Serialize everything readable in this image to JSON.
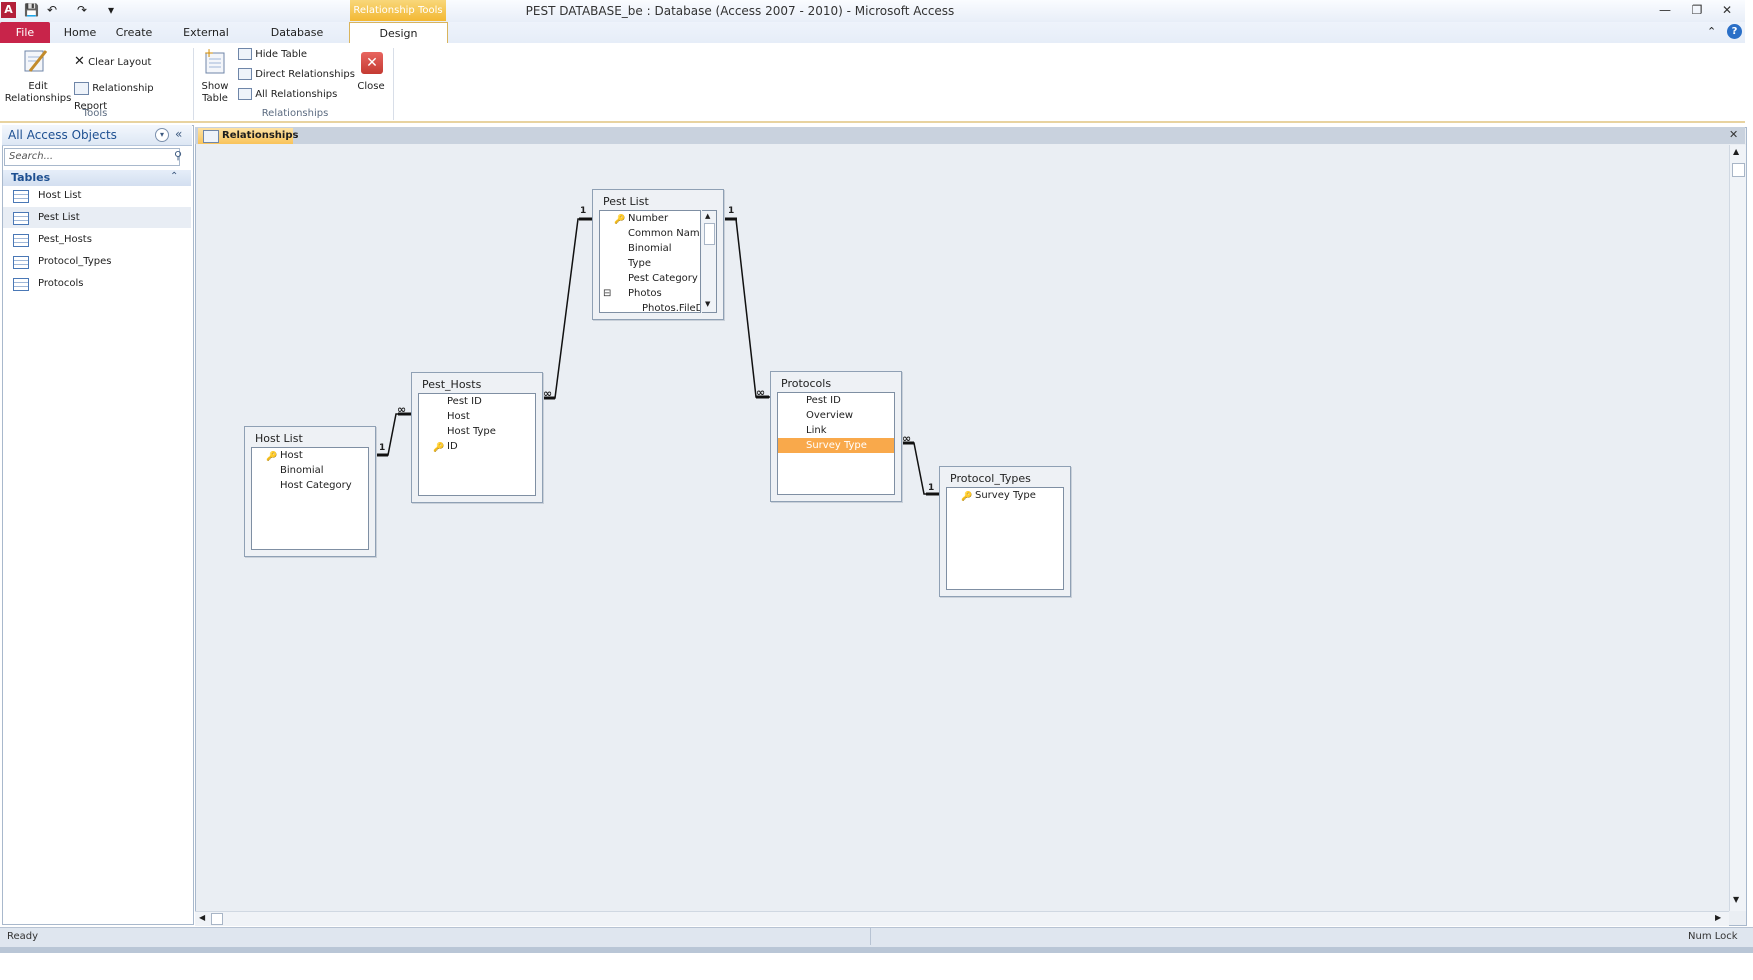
{
  "window": {
    "title": "PEST DATABASE_be : Database (Access 2007 - 2010)  -  Microsoft Access",
    "contextual_tab_group": "Relationship Tools",
    "logo": "A"
  },
  "tabs": [
    "File",
    "Home",
    "Create",
    "External Data",
    "Database Tools",
    "Design"
  ],
  "ribbon": {
    "tools_group": {
      "label": "Tools",
      "edit_relationships": "Edit\nRelationships",
      "clear_layout": "Clear Layout",
      "relationship_report": "Relationship Report"
    },
    "relationships_group": {
      "label": "Relationships",
      "show_table": "Show\nTable",
      "hide_table": "Hide Table",
      "direct_relationships": "Direct Relationships",
      "all_relationships": "All Relationships",
      "close": "Close"
    }
  },
  "nav_pane": {
    "title": "All Access Objects",
    "search_placeholder": "Search...",
    "section": "Tables",
    "items": [
      "Host List",
      "Pest List",
      "Pest_Hosts",
      "Protocol_Types",
      "Protocols"
    ],
    "selected": "Pest List"
  },
  "document": {
    "tab_label": "Relationships",
    "tables": {
      "pest_list": {
        "name": "Pest List",
        "fields": [
          "Number",
          "Common Name",
          "Binomial",
          "Type",
          "Pest Category",
          "Photos",
          "Photos.FileD"
        ],
        "key_field": "Number"
      },
      "pest_hosts": {
        "name": "Pest_Hosts",
        "fields": [
          "Pest ID",
          "Host",
          "Host Type",
          "ID"
        ],
        "key_field": "ID"
      },
      "host_list": {
        "name": "Host List",
        "fields": [
          "Host",
          "Binomial",
          "Host Category"
        ],
        "key_field": "Host"
      },
      "protocols": {
        "name": "Protocols",
        "fields": [
          "Pest ID",
          "Overview",
          "Link",
          "Survey Type"
        ],
        "selected_field": "Survey Type"
      },
      "protocol_types": {
        "name": "Protocol_Types",
        "fields": [
          "Survey Type"
        ],
        "key_field": "Survey Type"
      }
    },
    "cardinality": {
      "one": "1",
      "many": "∞"
    }
  },
  "status": {
    "left": "Ready",
    "right": "Num Lock"
  },
  "colors": {
    "file_tab": "#c8244a",
    "contextual": "#f3b833",
    "highlight": "#f9a94b",
    "canvas": "#eaeef3"
  }
}
